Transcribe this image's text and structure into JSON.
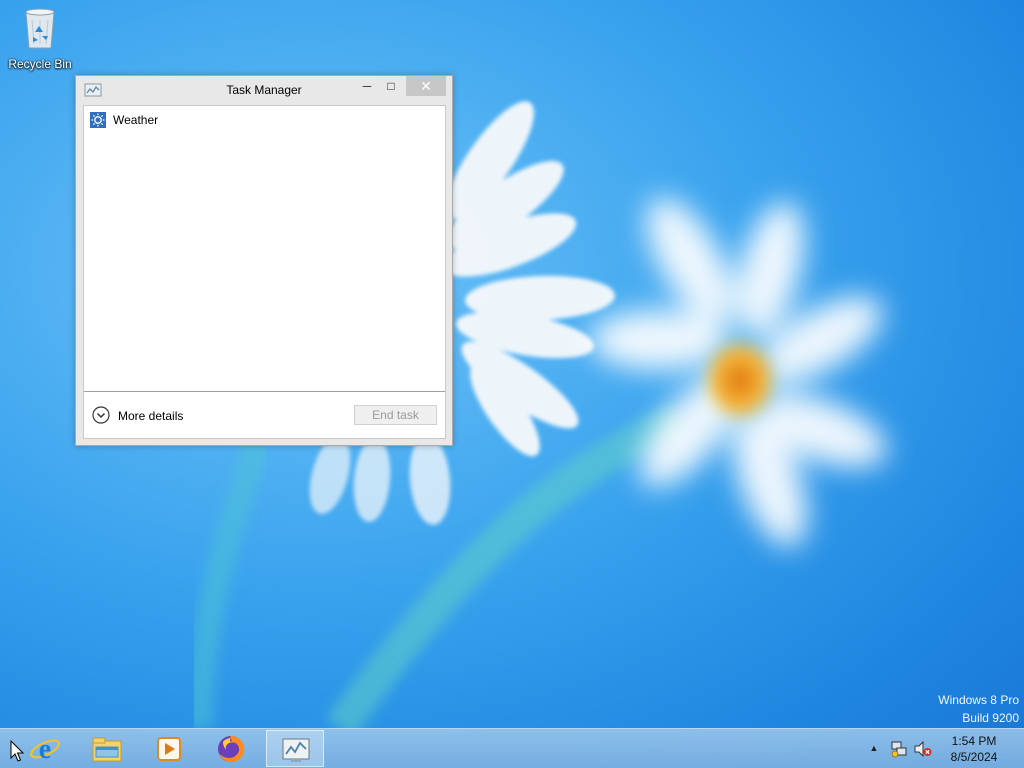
{
  "desktop": {
    "icons": [
      {
        "label": "Recycle Bin",
        "icon": "recycle-bin-icon"
      }
    ],
    "watermark": {
      "line1": "Windows 8 Pro",
      "line2": "Build 9200"
    }
  },
  "task_manager": {
    "title": "Task Manager",
    "title_icon": "task-manager-icon",
    "caption_buttons": {
      "minimize": "minimize-icon",
      "maximize": "maximize-icon",
      "close": "close-icon"
    },
    "processes": [
      {
        "name": "Weather",
        "icon": "weather-icon"
      }
    ],
    "more_details_label": "More details",
    "end_task_label": "End task"
  },
  "taskbar": {
    "pinned": [
      {
        "name": "Internet Explorer",
        "icon": "internet-explorer-icon"
      },
      {
        "name": "File Explorer",
        "icon": "file-explorer-icon"
      },
      {
        "name": "Windows Media Player",
        "icon": "media-player-icon"
      },
      {
        "name": "Firefox",
        "icon": "firefox-icon"
      },
      {
        "name": "Task Manager",
        "icon": "task-manager-icon",
        "active": true
      }
    ],
    "tray": {
      "icons": [
        "show-hidden-icons-icon",
        "network-icon",
        "volume-muted-icon"
      ]
    },
    "clock": {
      "time": "1:54 PM",
      "date": "8/5/2024"
    }
  },
  "colors": {
    "desktop_blue": "#3aa3ee",
    "window_frame": "#e8e8e8",
    "close_button": "#c7c7c7",
    "taskbar": "#8fbde6"
  }
}
